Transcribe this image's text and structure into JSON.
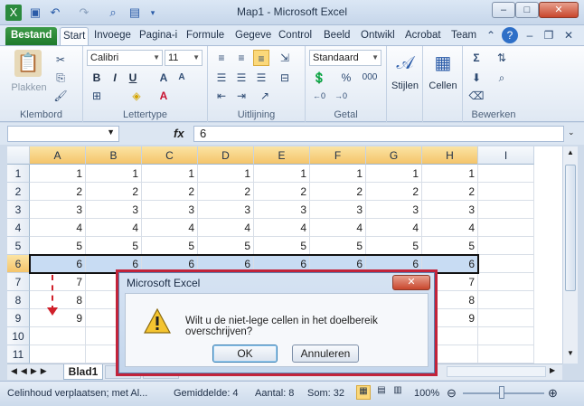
{
  "window": {
    "title": "Map1 - Microsoft Excel",
    "minimize": "–",
    "maximize": "□",
    "close": "✕"
  },
  "quick_access": [
    "excel-logo-icon",
    "save-icon",
    "undo-icon",
    "redo-icon",
    "print-preview-icon",
    "form-icon"
  ],
  "tabs": [
    {
      "label": "Bestand"
    },
    {
      "label": "Start"
    },
    {
      "label": "Invoege"
    },
    {
      "label": "Pagina-i"
    },
    {
      "label": "Formule"
    },
    {
      "label": "Gegeve"
    },
    {
      "label": "Control"
    },
    {
      "label": "Beeld"
    },
    {
      "label": "Ontwikl"
    },
    {
      "label": "Acrobat"
    },
    {
      "label": "Team"
    }
  ],
  "ribbon": {
    "clipboard": {
      "label": "Klembord",
      "paste": "Plakken"
    },
    "font": {
      "label": "Lettertype",
      "family": "Calibri",
      "size": "11",
      "bold": "B",
      "italic": "I",
      "underline": "U",
      "grow": "A",
      "shrink": "A"
    },
    "alignment": {
      "label": "Uitlijning"
    },
    "number": {
      "label": "Getal",
      "format": "Standaard",
      "percent": "%",
      "thousands": "000"
    },
    "styles": {
      "label": "Stijlen"
    },
    "cells": {
      "label": "Cellen"
    },
    "editing": {
      "label": "Bewerken"
    }
  },
  "formula_bar": {
    "fx": "fx",
    "value": "6"
  },
  "grid": {
    "columns": [
      "A",
      "B",
      "C",
      "D",
      "E",
      "F",
      "G",
      "H",
      "I"
    ],
    "rows": [
      {
        "num": "1",
        "cells": [
          "1",
          "1",
          "1",
          "1",
          "1",
          "1",
          "1",
          "1",
          ""
        ]
      },
      {
        "num": "2",
        "cells": [
          "2",
          "2",
          "2",
          "2",
          "2",
          "2",
          "2",
          "2",
          ""
        ]
      },
      {
        "num": "3",
        "cells": [
          "3",
          "3",
          "3",
          "3",
          "3",
          "3",
          "3",
          "3",
          ""
        ]
      },
      {
        "num": "4",
        "cells": [
          "4",
          "4",
          "4",
          "4",
          "4",
          "4",
          "4",
          "4",
          ""
        ]
      },
      {
        "num": "5",
        "cells": [
          "5",
          "5",
          "5",
          "5",
          "5",
          "5",
          "5",
          "5",
          ""
        ]
      },
      {
        "num": "6",
        "cells": [
          "6",
          "6",
          "6",
          "6",
          "6",
          "6",
          "6",
          "6",
          ""
        ]
      },
      {
        "num": "7",
        "cells": [
          "7",
          "",
          "",
          "",
          "",
          "",
          "",
          "7",
          ""
        ]
      },
      {
        "num": "8",
        "cells": [
          "8",
          "",
          "",
          "",
          "",
          "",
          "",
          "8",
          ""
        ]
      },
      {
        "num": "9",
        "cells": [
          "9",
          "",
          "",
          "",
          "",
          "",
          "",
          "9",
          ""
        ]
      },
      {
        "num": "10",
        "cells": [
          "",
          "",
          "",
          "",
          "",
          "",
          "",
          "",
          ""
        ]
      },
      {
        "num": "11",
        "cells": [
          "",
          "",
          "",
          "",
          "",
          "",
          "",
          "",
          ""
        ]
      }
    ],
    "selected_row": "6"
  },
  "sheet_tabs": {
    "active": "Blad1"
  },
  "status": {
    "message": "Celinhoud verplaatsen; met Al...",
    "average": "Gemiddelde: 4",
    "count": "Aantal: 8",
    "sum": "Som: 32",
    "zoom": "100%"
  },
  "dialog": {
    "title": "Microsoft Excel",
    "message": "Wilt u de niet-lege cellen in het doelbereik overschrijven?",
    "ok": "OK",
    "cancel": "Annuleren"
  },
  "colors": {
    "accent_red": "#c2233a",
    "file_tab": "#2e8b3a",
    "selection": "#c8dcf3"
  }
}
